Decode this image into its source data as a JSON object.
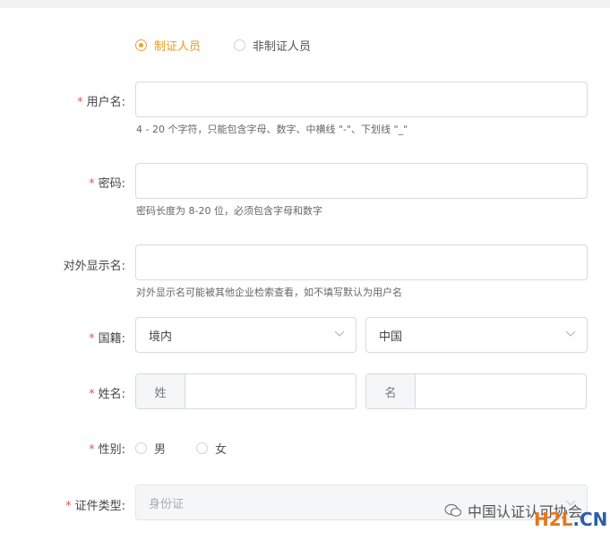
{
  "personnel_type": {
    "options": [
      {
        "label": "制证人员",
        "checked": true
      },
      {
        "label": "非制证人员",
        "checked": false
      }
    ]
  },
  "form": {
    "username": {
      "required": true,
      "label": "用户名:",
      "value": "",
      "hint": "4 - 20 个字符，只能包含字母、数字、中横线 \"-\"、下划线 \"_\""
    },
    "password": {
      "required": true,
      "label": "密码:",
      "value": "",
      "hint": "密码长度为 8-20 位，必须包含字母和数字"
    },
    "display_name": {
      "required": false,
      "label": "对外显示名:",
      "value": "",
      "hint": "对外显示名可能被其他企业检索查看，如不填写默认为用户名"
    },
    "nationality": {
      "required": true,
      "label": "国籍:",
      "region_value": "境内",
      "country_value": "中国"
    },
    "name": {
      "required": true,
      "label": "姓名:",
      "surname_addon": "姓",
      "given_addon": "名",
      "surname_value": "",
      "given_value": ""
    },
    "gender": {
      "required": true,
      "label": "性别:",
      "options": [
        {
          "label": "男",
          "checked": false
        },
        {
          "label": "女",
          "checked": false
        }
      ]
    },
    "id_type": {
      "required": true,
      "label": "证件类型:",
      "value": "身份证"
    }
  },
  "watermark": {
    "text": "中国认证认可协会",
    "logo_main": "H2L",
    "logo_suffix": ".CN"
  },
  "colors": {
    "accent": "#e9a23b",
    "required_star": "#e45656",
    "border": "#d7dadf"
  }
}
